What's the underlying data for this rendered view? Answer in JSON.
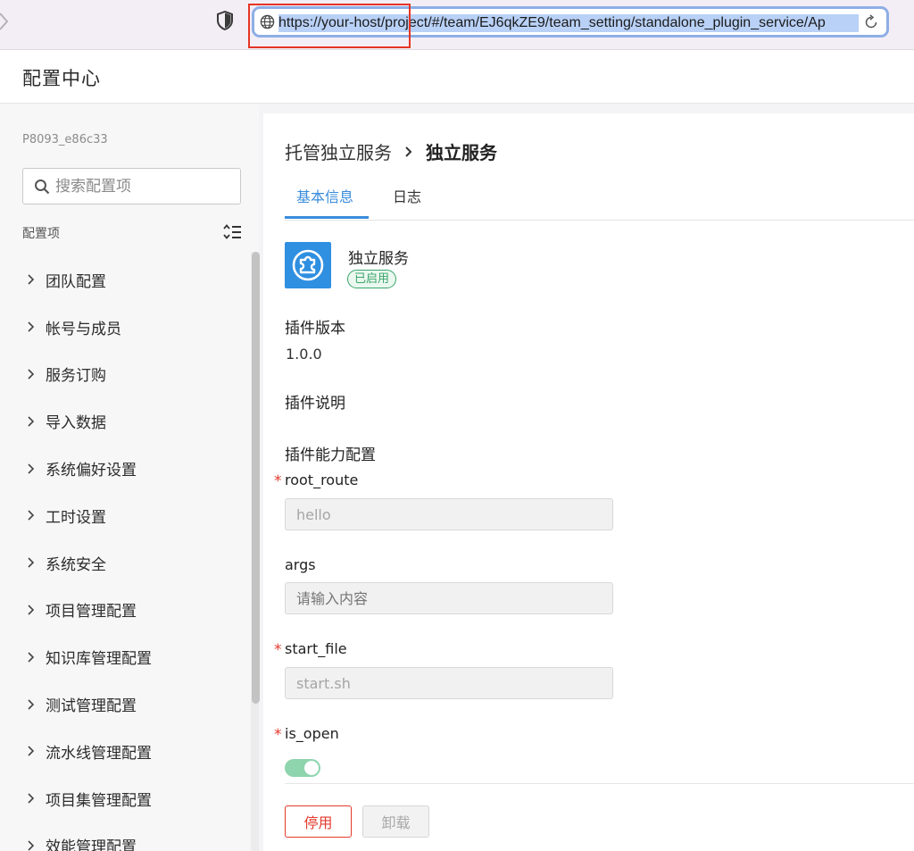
{
  "browser": {
    "url": "https://your-host/project/#/team/EJ6qkZE9/team_setting/standalone_plugin_service/Ap"
  },
  "app": {
    "title": "配置中心"
  },
  "sidebar": {
    "team_id": "P8093_e86c33",
    "search_placeholder": "搜索配置项",
    "section_label": "配置项",
    "items": [
      {
        "label": "团队配置"
      },
      {
        "label": "帐号与成员"
      },
      {
        "label": "服务订购"
      },
      {
        "label": "导入数据"
      },
      {
        "label": "系统偏好设置"
      },
      {
        "label": "工时设置"
      },
      {
        "label": "系统安全"
      },
      {
        "label": "项目管理配置"
      },
      {
        "label": "知识库管理配置"
      },
      {
        "label": "测试管理配置"
      },
      {
        "label": "流水线管理配置"
      },
      {
        "label": "项目集管理配置"
      },
      {
        "label": "效能管理配置"
      }
    ]
  },
  "main": {
    "breadcrumb": {
      "parent": "托管独立服务",
      "current": "独立服务"
    },
    "tabs": [
      {
        "label": "基本信息",
        "active": true
      },
      {
        "label": "日志",
        "active": false
      }
    ],
    "plugin": {
      "name": "独立服务",
      "status": "已启用",
      "icon": "puzzle-icon",
      "icon_color": "#2f8fe0"
    },
    "version_label": "插件版本",
    "version_value": "1.0.0",
    "description_label": "插件说明",
    "capability_label": "插件能力配置",
    "fields": {
      "root_route": {
        "label": "root_route",
        "required": true,
        "value": "hello"
      },
      "args": {
        "label": "args",
        "required": false,
        "placeholder": "请输入内容"
      },
      "start_file": {
        "label": "start_file",
        "required": true,
        "value": "start.sh"
      },
      "is_open": {
        "label": "is_open",
        "required": true,
        "on": true
      }
    },
    "buttons": {
      "disable": "停用",
      "uninstall": "卸载"
    }
  },
  "colors": {
    "accent": "#3a8cdc",
    "danger": "#e33a2c",
    "success": "#3aa46a"
  }
}
